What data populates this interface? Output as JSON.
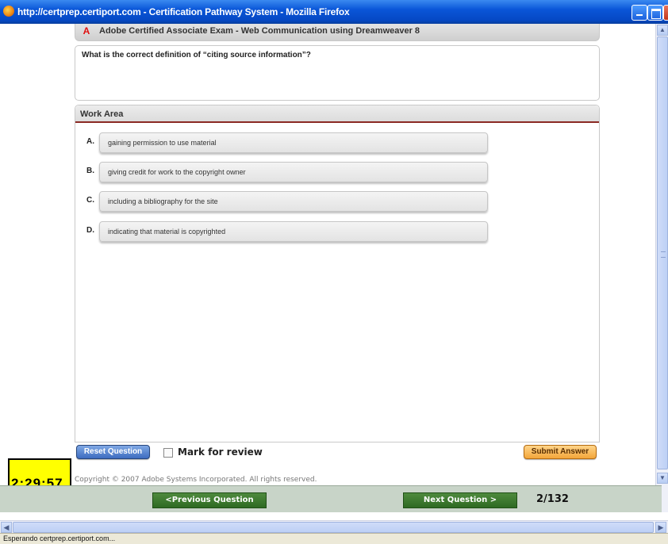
{
  "window": {
    "title": "http://certprep.certiport.com - Certification Pathway System - Mozilla Firefox"
  },
  "exam": {
    "title": "Adobe Certified Associate Exam - Web Communication using Dreamweaver 8"
  },
  "question": {
    "text": "What is the correct definition of “citing source information”?"
  },
  "work_area": {
    "title": "Work Area",
    "options": [
      {
        "letter": "A.",
        "text": "gaining permission to use material"
      },
      {
        "letter": "B.",
        "text": "giving credit for work to the copyright owner"
      },
      {
        "letter": "C.",
        "text": "including a bibliography for the site"
      },
      {
        "letter": "D.",
        "text": "indicating that material is copyrighted"
      }
    ]
  },
  "actions": {
    "reset_label": "Reset Question",
    "mark_label": "Mark for review",
    "mark_checked": false,
    "submit_label": "Submit Answer"
  },
  "timer": {
    "value": "2:29:57"
  },
  "footer": {
    "copyright": "Copyright © 2007 Adobe Systems Incorporated. All rights reserved."
  },
  "navigation": {
    "prev_label": "<Previous Question",
    "next_label": "Next Question >",
    "question_count": "2/132"
  },
  "status": {
    "text": "Esperando certprep.certiport.com..."
  },
  "colors": {
    "titlebar": "#0a56d8",
    "workarea_rule": "#8b2a24",
    "nav_button": "#2e6a22",
    "submit_button": "#f3a63a",
    "reset_button": "#3e6cc0",
    "timer_bg": "#ffff00"
  },
  "icons": {
    "browser": "firefox-icon",
    "exam": "adobe-icon"
  }
}
